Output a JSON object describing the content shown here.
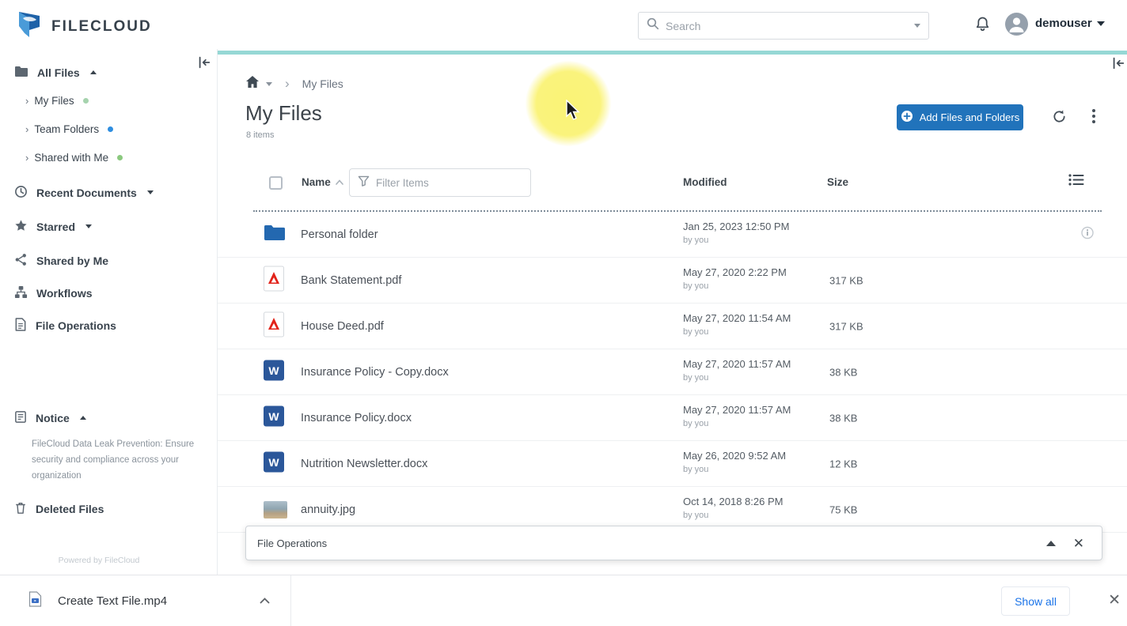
{
  "topbar": {
    "logo_text": "FILECLOUD",
    "search_placeholder": "Search",
    "username": "demouser"
  },
  "sidebar": {
    "all_files": "All Files",
    "my_files": "My Files",
    "team_folders": "Team Folders",
    "shared_with_me": "Shared with Me",
    "recent_documents": "Recent Documents",
    "starred": "Starred",
    "shared_by_me": "Shared by Me",
    "workflows": "Workflows",
    "file_operations": "File Operations",
    "notice_title": "Notice",
    "notice_text": "FileCloud Data Leak Prevention: Ensure security and compliance across your organization",
    "deleted_files": "Deleted Files",
    "powered_by": "Powered by FileCloud"
  },
  "main": {
    "breadcrumb_current": "My Files",
    "title": "My Files",
    "item_count": "8 items",
    "add_button_label": "Add Files and Folders",
    "table": {
      "name_header": "Name",
      "filter_placeholder": "Filter Items",
      "modified_header": "Modified",
      "size_header": "Size",
      "rows": [
        {
          "name": "Personal folder",
          "type": "folder",
          "modified": "Jan 25, 2023 12:50 PM",
          "by": "by you",
          "size": ""
        },
        {
          "name": "Bank Statement.pdf",
          "type": "pdf",
          "modified": "May 27, 2020 2:22 PM",
          "by": "by you",
          "size": "317 KB"
        },
        {
          "name": "House Deed.pdf",
          "type": "pdf",
          "modified": "May 27, 2020 11:54 AM",
          "by": "by you",
          "size": "317 KB"
        },
        {
          "name": "Insurance Policy - Copy.docx",
          "type": "word",
          "modified": "May 27, 2020 11:57 AM",
          "by": "by you",
          "size": "38 KB"
        },
        {
          "name": "Insurance Policy.docx",
          "type": "word",
          "modified": "May 27, 2020 11:57 AM",
          "by": "by you",
          "size": "38 KB"
        },
        {
          "name": "Nutrition Newsletter.docx",
          "type": "word",
          "modified": "May 26, 2020 9:52 AM",
          "by": "by you",
          "size": "12 KB"
        },
        {
          "name": "annuity.jpg",
          "type": "image",
          "modified": "Oct 14, 2018 8:26 PM",
          "by": "by you",
          "size": "75 KB"
        }
      ]
    }
  },
  "file_operations_panel": {
    "title": "File Operations"
  },
  "downloads_bar": {
    "filename": "Create Text File.mp4",
    "show_all_label": "Show all"
  },
  "colors": {
    "accent_teal": "#96d8d5",
    "primary_blue": "#2173bb",
    "link_blue": "#1a73e8",
    "folder_blue": "#2368b0",
    "word_blue": "#2b579a",
    "pdf_red": "#e2231a"
  }
}
